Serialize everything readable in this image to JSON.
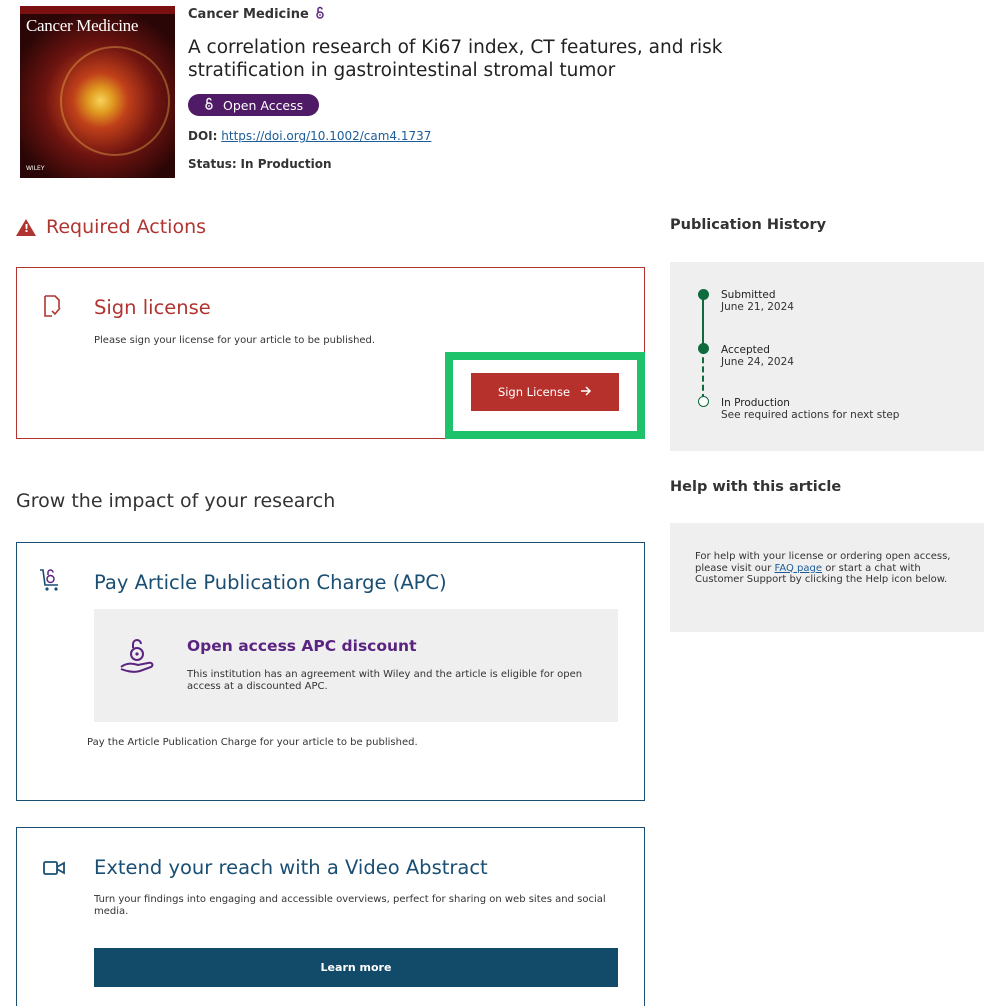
{
  "article": {
    "cover_title": "Cancer Medicine",
    "journal": "Cancer Medicine",
    "title": "A correlation research of Ki67 index, CT features, and risk stratification in gastrointestinal stromal tumor",
    "open_access_label": "Open Access",
    "doi_label": "DOI:",
    "doi_url": "https://doi.org/10.1002/cam4.1737",
    "status_label": "Status:",
    "status_value": "In Production",
    "cover_publisher": "WILEY"
  },
  "required_actions": {
    "heading": "Required Actions",
    "license": {
      "title": "Sign license",
      "description": "Please sign your license for your article to be published.",
      "button_label": "Sign License"
    }
  },
  "grow": {
    "heading": "Grow the impact of your research",
    "apc": {
      "title": "Pay Article Publication Charge (APC)",
      "discount_title": "Open access APC discount",
      "discount_description": "This institution has an agreement with Wiley and the article is eligible for open access at a discounted APC.",
      "footer": "Pay the Article Publication Charge for your article to be published."
    },
    "video": {
      "title": "Extend your reach with a Video Abstract",
      "description": "Turn your findings into engaging and accessible overviews, perfect for sharing on web sites and social media.",
      "button_label": "Learn more"
    }
  },
  "publication_history": {
    "heading": "Publication History",
    "steps": [
      {
        "label": "Submitted",
        "detail": "June 21, 2024"
      },
      {
        "label": "Accepted",
        "detail": "June 24, 2024"
      },
      {
        "label": "In Production",
        "detail": "See required actions for next step"
      }
    ]
  },
  "help": {
    "heading": "Help with this article",
    "text_before_link": "For help with your license or ordering open access, please visit our ",
    "link_text": "FAQ page",
    "text_after_link": " or start a chat with Customer Support by clicking the Help icon below."
  },
  "colors": {
    "required_red": "#b03430",
    "open_access_purple": "#4f1a66",
    "highlight_green": "#1ec26a",
    "timeline_green": "#0f6b3e",
    "card_blue": "#1a4e72"
  },
  "icons": {
    "journal_oa": "open-access-lock-icon",
    "warning": "warning-triangle-icon",
    "license": "document-check-icon",
    "apc": "cart-open-access-icon",
    "discount": "hand-open-access-icon",
    "video": "video-camera-icon",
    "arrow": "arrow-right-icon"
  }
}
